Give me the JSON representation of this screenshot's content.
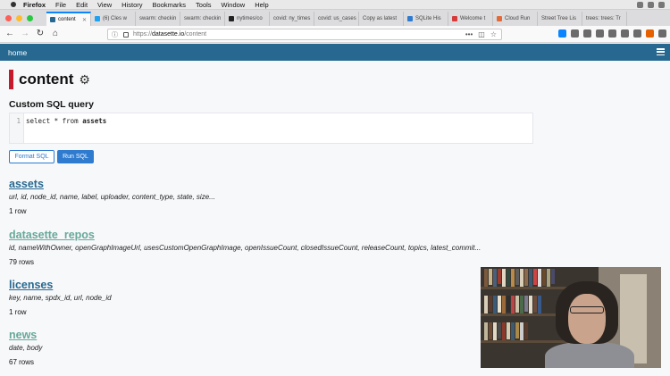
{
  "menubar": {
    "items": [
      "Firefox",
      "File",
      "Edit",
      "View",
      "History",
      "Bookmarks",
      "Tools",
      "Window",
      "Help"
    ]
  },
  "tabs": [
    {
      "label": "content",
      "active": true
    },
    {
      "label": "(6) Cles w",
      "active": false
    },
    {
      "label": "swarm: checkin",
      "active": false
    },
    {
      "label": "swarm: checkin",
      "active": false
    },
    {
      "label": "nytimes/co",
      "active": false
    },
    {
      "label": "covid: ny_times",
      "active": false
    },
    {
      "label": "covid: us_cases",
      "active": false
    },
    {
      "label": "Copy as latest",
      "active": false
    },
    {
      "label": "SQLite His",
      "active": false
    },
    {
      "label": "Welcome t",
      "active": false
    },
    {
      "label": "Cloud Run",
      "active": false
    },
    {
      "label": "Street Tree Lis",
      "active": false
    },
    {
      "label": "trees: trees: Tr",
      "active": false
    }
  ],
  "navbar": {
    "url_scheme": "https://",
    "url_host": "datasette.io",
    "url_path": "/content",
    "ext_more": "•••"
  },
  "header": {
    "home_label": "home"
  },
  "page": {
    "title": "content",
    "sql_heading": "Custom SQL query",
    "sql_line_number": "1",
    "sql_keyword_select": "select",
    "sql_star_from": " * from ",
    "sql_table": "assets",
    "format_button": "Format SQL",
    "run_button": "Run SQL"
  },
  "tables": [
    {
      "name": "assets",
      "columns": "url, id, node_id, name, label, uploader, content_type, state, size...",
      "rows": "1 row",
      "color": "#276890"
    },
    {
      "name": "datasette_repos",
      "columns": "id, nameWithOwner, openGraphImageUrl, usesCustomOpenGraphImage, openIssueCount, closedIssueCount, releaseCount, topics, latest_commit...",
      "rows": "79 rows",
      "color": "#67a899"
    },
    {
      "name": "licenses",
      "columns": "key, name, spdx_id, url, node_id",
      "rows": "1 row",
      "color": "#276890"
    },
    {
      "name": "news",
      "columns": "date, body",
      "rows": "67 rows",
      "color": "#67a899"
    }
  ],
  "colors": {
    "header_bg": "#276890",
    "title_accent": "#c41a2b",
    "button_blue": "#2e7bd0",
    "tab_active_border": "#0a84ff"
  }
}
